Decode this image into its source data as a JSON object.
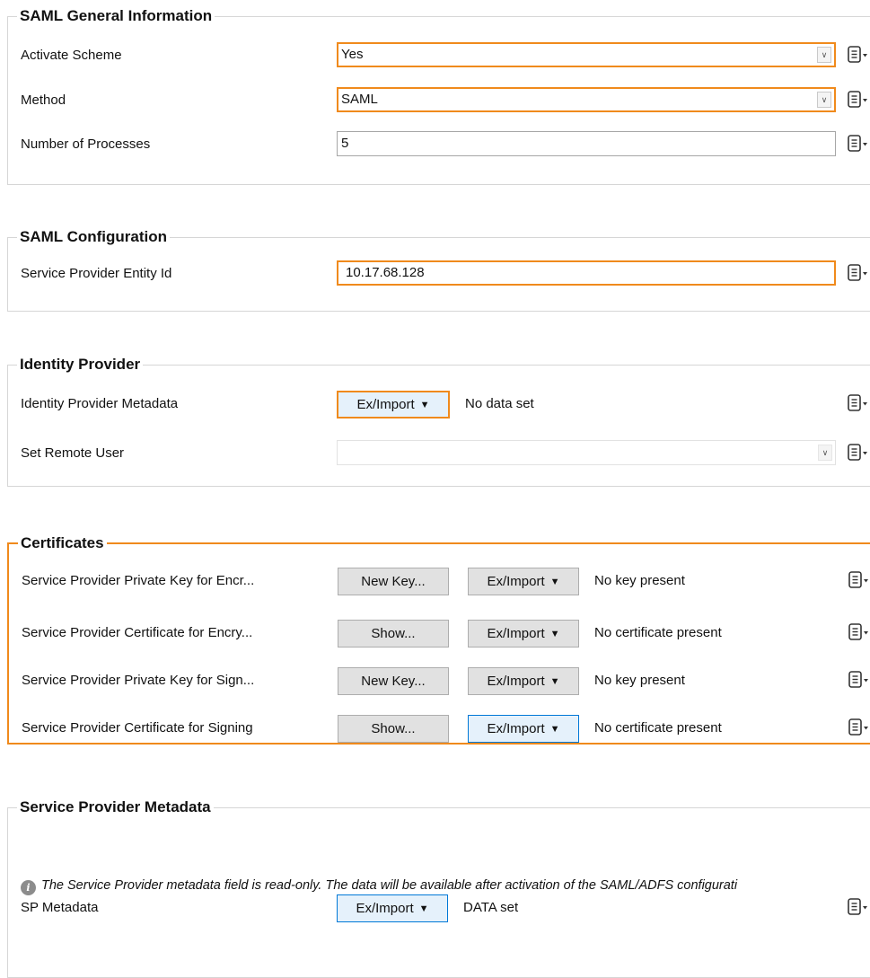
{
  "general": {
    "title": "SAML General Information",
    "activate": {
      "label": "Activate Scheme",
      "value": "Yes"
    },
    "method": {
      "label": "Method",
      "value": "SAML"
    },
    "processes": {
      "label": "Number of Processes",
      "value": "5"
    }
  },
  "config": {
    "title": "SAML Configuration",
    "entity": {
      "label": "Service Provider Entity Id",
      "value": "10.17.68.128"
    }
  },
  "idp": {
    "title": "Identity Provider",
    "metadata": {
      "label": "Identity Provider Metadata",
      "button": "Ex/Import",
      "status": "No data set"
    },
    "remote_user": {
      "label": "Set Remote User",
      "value": ""
    }
  },
  "certs": {
    "title": "Certificates",
    "rows": [
      {
        "label": "Service Provider Private Key for Encr...",
        "action": "New Key...",
        "import": "Ex/Import",
        "status": "No key present"
      },
      {
        "label": "Service Provider Certificate for Encry...",
        "action": "Show...",
        "import": "Ex/Import",
        "status": "No certificate present"
      },
      {
        "label": "Service Provider Private Key for Sign...",
        "action": "New Key...",
        "import": "Ex/Import",
        "status": "No key present"
      },
      {
        "label": "Service Provider Certificate for Signing",
        "action": "Show...",
        "import": "Ex/Import",
        "status": "No certificate present"
      }
    ]
  },
  "spmeta": {
    "title": "Service Provider Metadata",
    "info": "The Service Provider metadata field is read-only. The data will be available after activation of the SAML/ADFS configurati",
    "metadata": {
      "label": "SP Metadata",
      "button": "Ex/Import",
      "status": "DATA set"
    }
  },
  "icons": {
    "info": "i",
    "caret": "▼",
    "dropdown": "∨",
    "options_menu": "options-menu-icon"
  },
  "colors": {
    "accent": "#f08a1c",
    "focus": "#0078d7",
    "button_bg": "#e1e1e1"
  }
}
